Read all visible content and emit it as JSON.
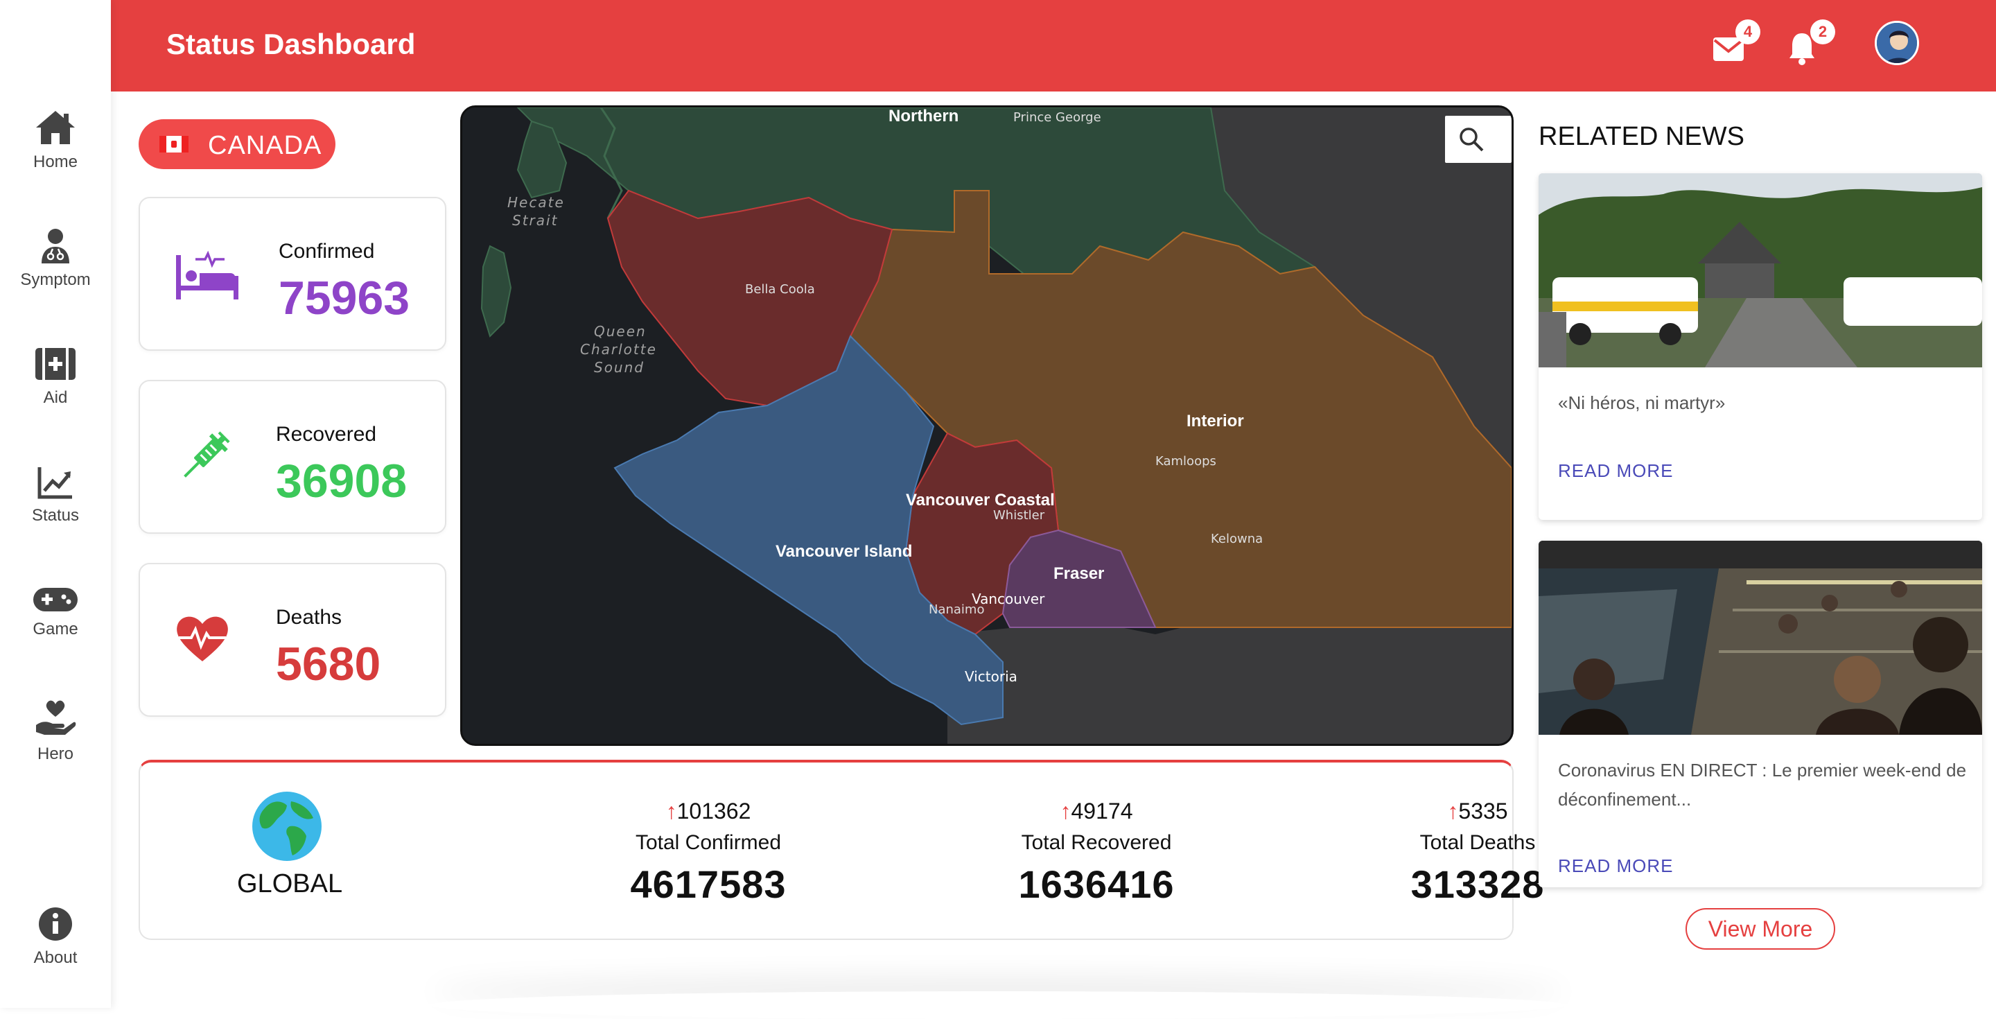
{
  "header": {
    "title": "Status Dashboard",
    "mail_count": "4",
    "notification_count": "2"
  },
  "sidebar": {
    "items": [
      {
        "label": "Home",
        "icon": "home-icon"
      },
      {
        "label": "Symptom",
        "icon": "doctor-icon"
      },
      {
        "label": "Aid",
        "icon": "first-aid-icon"
      },
      {
        "label": "Status",
        "icon": "chart-line-icon"
      },
      {
        "label": "Game",
        "icon": "gamepad-icon"
      },
      {
        "label": "Hero",
        "icon": "hand-heart-icon"
      },
      {
        "label": "About",
        "icon": "info-icon"
      }
    ]
  },
  "country": {
    "name": "CANADA",
    "flag": "canada-flag"
  },
  "stats": {
    "confirmed": {
      "label": "Confirmed",
      "value": "75963",
      "color": "#8e44c8"
    },
    "recovered": {
      "label": "Recovered",
      "value": "36908",
      "color": "#3cc85a"
    },
    "deaths": {
      "label": "Deaths",
      "value": "5680",
      "color": "#d63c3c"
    }
  },
  "map": {
    "regions": [
      {
        "name": "Northern",
        "color": "#2d4a3a"
      },
      {
        "name": "Interior",
        "color": "#6b4a2a"
      },
      {
        "name": "Vancouver Coastal",
        "color": "#6a2c2c"
      },
      {
        "name": "Vancouver Island",
        "color": "#3a5a80"
      },
      {
        "name": "Fraser",
        "color": "#5a3a60"
      }
    ],
    "places": [
      "Prince George",
      "Bella Coola",
      "Kamloops",
      "Kelowna",
      "Whistler",
      "Vancouver",
      "Nanaimo",
      "Victoria"
    ],
    "water": [
      "Hecate Strait",
      "Queen Charlotte Sound"
    ],
    "water_lines": [
      [
        "Hecate",
        "Strait"
      ],
      [
        "Queen",
        "Charlotte",
        "Sound"
      ]
    ]
  },
  "global": {
    "label": "GLOBAL",
    "confirmed": {
      "delta": "101362",
      "label": "Total Confirmed",
      "value": "4617583"
    },
    "recovered": {
      "delta": "49174",
      "label": "Total Recovered",
      "value": "1636416"
    },
    "deaths": {
      "delta": "5335",
      "label": "Total Deaths",
      "value": "313328"
    }
  },
  "news": {
    "heading": "RELATED NEWS",
    "items": [
      {
        "title": "«Ni héros, ni martyr»",
        "read_more": "READ MORE"
      },
      {
        "title": "Coronavirus EN DIRECT : Le premier week-end de déconfinement...",
        "read_more": "READ MORE"
      }
    ],
    "view_more": "View More"
  },
  "colors": {
    "accent": "#e54040",
    "link": "#4a4ab8"
  }
}
